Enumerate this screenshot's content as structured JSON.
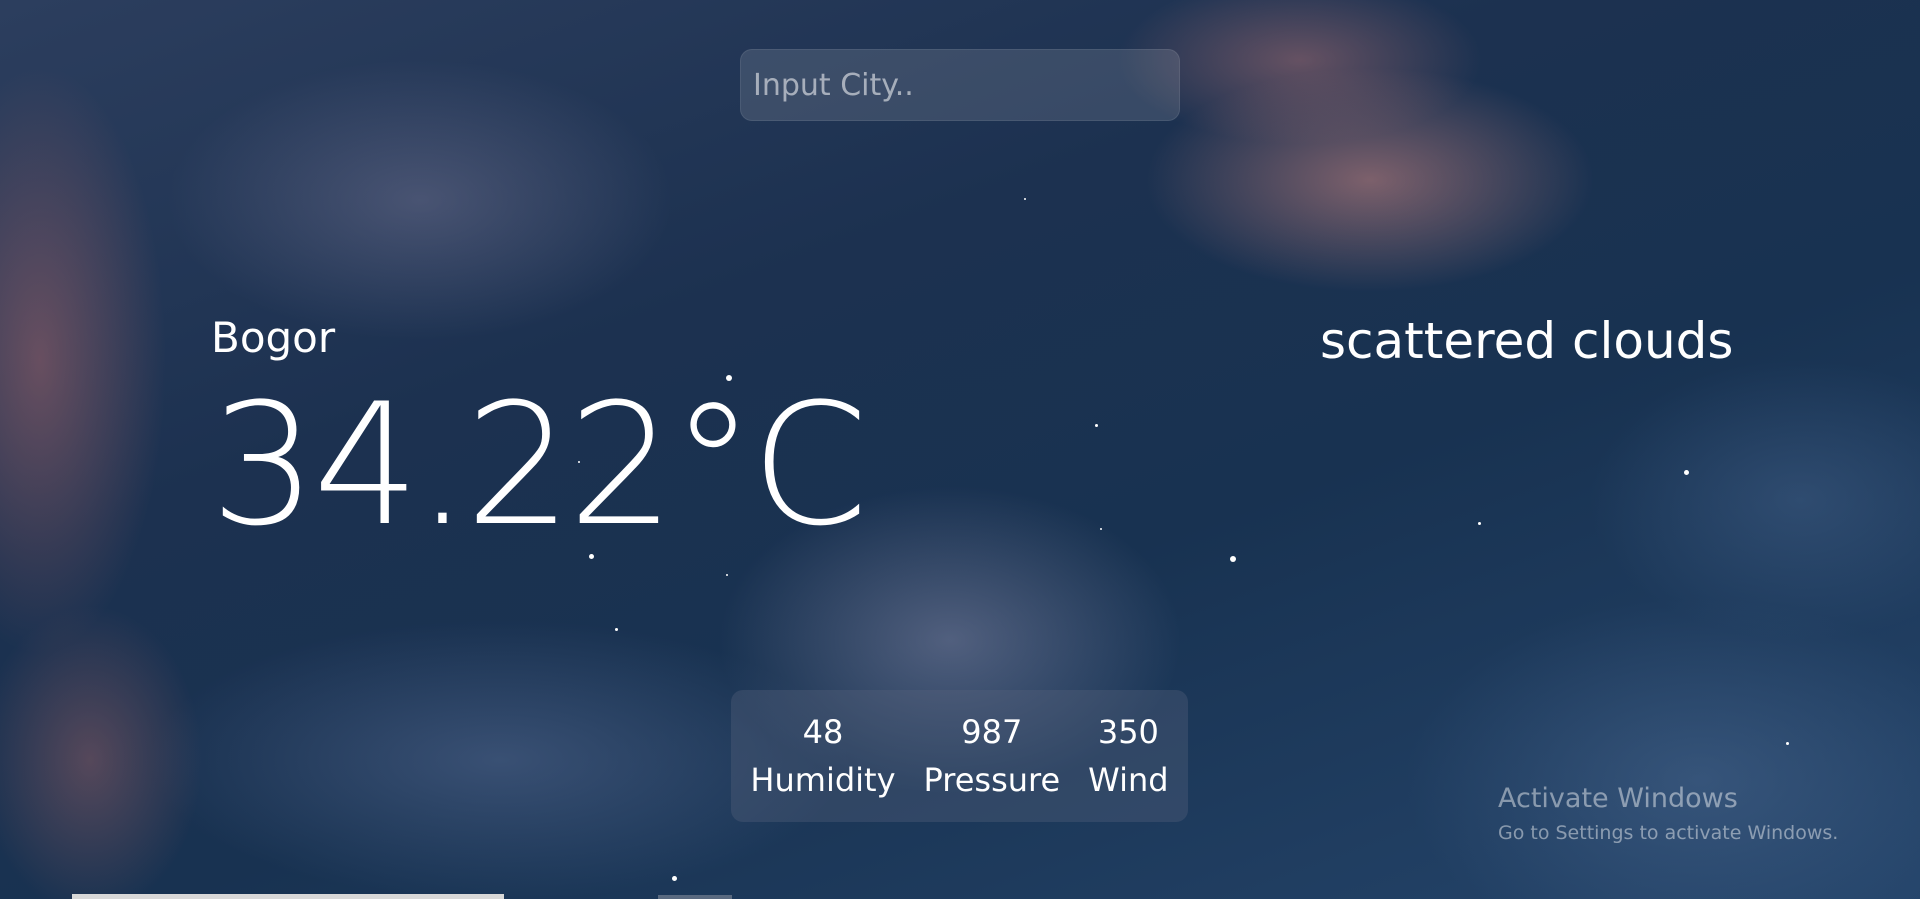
{
  "search": {
    "placeholder": "Input City.."
  },
  "weather": {
    "city": "Bogor",
    "temperature": "34.22°C",
    "description": "scattered clouds"
  },
  "stats": [
    {
      "value": "48",
      "label": "Humidity"
    },
    {
      "value": "987",
      "label": "Pressure"
    },
    {
      "value": "350",
      "label": "Wind"
    }
  ],
  "activation": {
    "title": "Activate Windows",
    "subtitle": "Go to Settings to activate Windows."
  },
  "colors": {
    "text": "#ffffff",
    "sky_dark": "#1c3150",
    "cloud_pink": "#cd8782"
  }
}
